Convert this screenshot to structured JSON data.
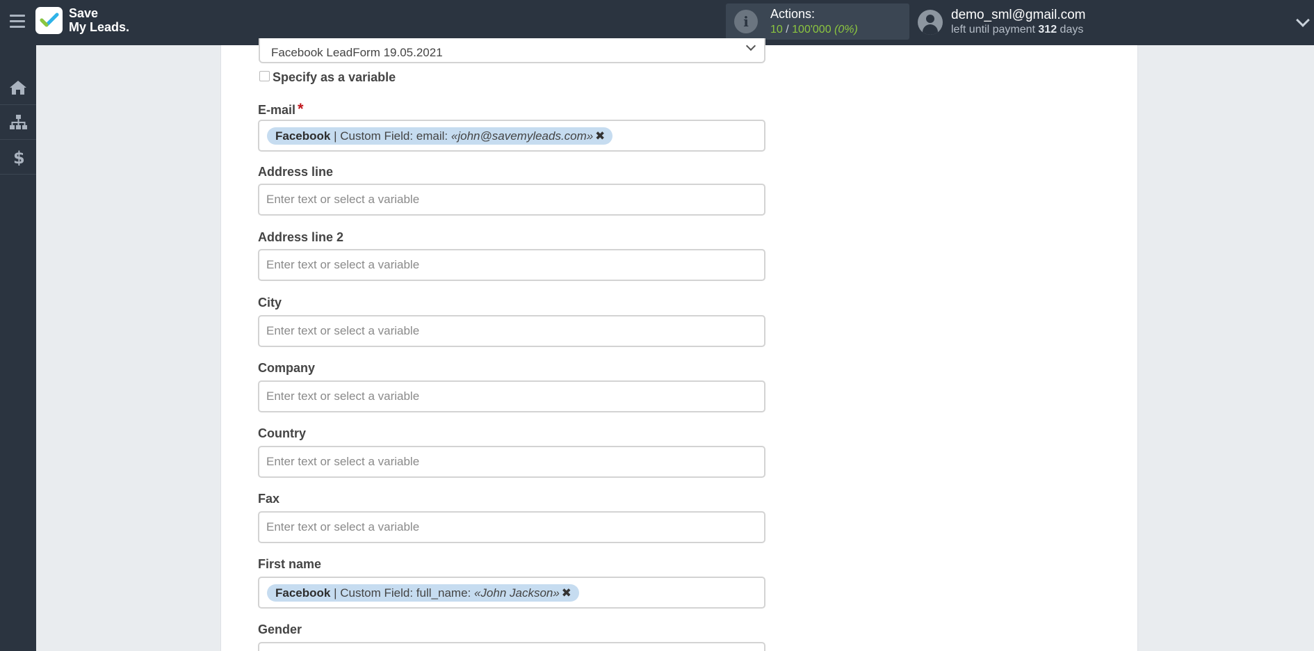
{
  "header": {
    "logo_line1": "Save",
    "logo_line2": "My Leads.",
    "actions_label": "Actions:",
    "actions_used": "10",
    "actions_sep": " / ",
    "actions_total": "100'000",
    "actions_pct": "(0%)",
    "user_email": "demo_sml@gmail.com",
    "payment_prefix": "left until payment ",
    "payment_days": "312",
    "payment_suffix": " days"
  },
  "sidebar": {
    "items": [
      {
        "icon": "home-icon"
      },
      {
        "icon": "sitemap-icon"
      },
      {
        "icon": "dollar-icon"
      }
    ]
  },
  "form": {
    "select_value": "Facebook LeadForm 19.05.2021",
    "checkbox_label": "Specify as a variable",
    "placeholder": "Enter text or select a variable",
    "fields": {
      "email": {
        "label": "E-mail",
        "required_mark": "*",
        "tag_source": "Facebook",
        "tag_field": " | Custom Field: email: ",
        "tag_value": "«john@savemyleads.com»",
        "tag_remove": "✖"
      },
      "address_line": {
        "label": "Address line"
      },
      "address_line_2": {
        "label": "Address line 2"
      },
      "city": {
        "label": "City"
      },
      "company": {
        "label": "Company"
      },
      "country": {
        "label": "Country"
      },
      "fax": {
        "label": "Fax"
      },
      "first_name": {
        "label": "First name",
        "tag_source": "Facebook",
        "tag_field": " | Custom Field: full_name: ",
        "tag_value": "«John Jackson»",
        "tag_remove": "✖"
      },
      "gender": {
        "label": "Gender"
      }
    }
  },
  "colors": {
    "topbar": "#2b3440",
    "accent_green": "#8cc63f",
    "tag_bg": "#c6dcf0",
    "required": "#c0161c"
  }
}
